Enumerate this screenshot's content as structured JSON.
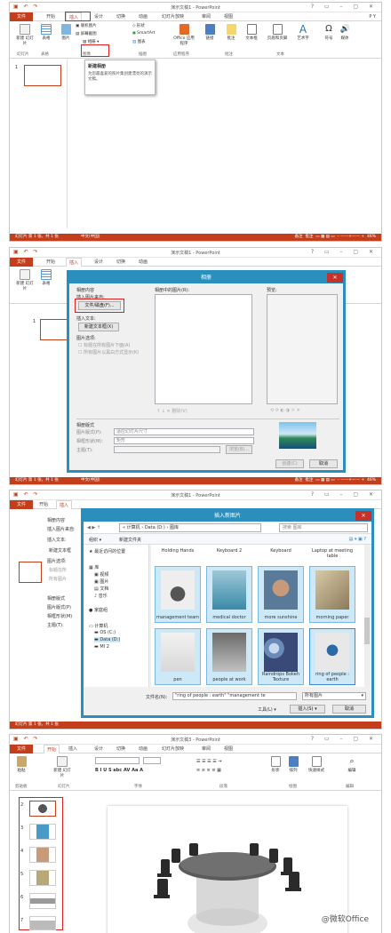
{
  "p1": {
    "title": "演示文稿1 - PowerPoint",
    "tabs": [
      "文件",
      "开始",
      "插入",
      "设计",
      "切换",
      "动画",
      "幻灯片放映",
      "审阅",
      "视图"
    ],
    "user": "P Y",
    "buttons": {
      "new_slide": "新建\n幻灯片",
      "table": "表格",
      "image": "图片",
      "online_image": "联机图片",
      "screenshot": "屏幕截图",
      "album": "相册",
      "shapes": "形状",
      "smartart": "SmartArt",
      "chart": "图表",
      "office_apps": "Office\n应用程序",
      "link": "链接",
      "comment": "批注",
      "textbox": "文本框",
      "header_footer": "页眉和页脚",
      "wordart": "艺术字",
      "symbol": "符号",
      "media": "媒体"
    },
    "groups": {
      "slides": "幻灯片",
      "tables": "表格",
      "images": "图像",
      "illustrations": "插图",
      "apps": "应用程序",
      "comments": "批注",
      "text": "文本"
    },
    "tooltip": {
      "title": "新建相册",
      "body": "为您最喜爱的照片集创建漂亮的演示文稿。"
    },
    "slide_num": "1",
    "status": "幻灯片 第 1 张，共 1 张",
    "lang": "中文(中国)",
    "notes": "备注",
    "comments": "批注",
    "zoom": "46%"
  },
  "p2": {
    "title": "演示文稿1 - PowerPoint",
    "dialog_title": "相册",
    "album_content": "相册内容",
    "insert_from": "插入图片来自:",
    "file_disk": "文件/磁盘(F)...",
    "insert_text": "插入文本:",
    "new_textbox": "新建文本框(X)",
    "pic_options": "图片选项:",
    "captions": "标题在所有图片下面(A)",
    "bw": "所有图片以黑白方式显示(K)",
    "pics_in_album": "相册中的图片(R):",
    "preview": "预览:",
    "remove": "删除(V)",
    "layout": "相册版式",
    "pic_layout_lbl": "图片版式(P):",
    "pic_layout_val": "适应幻灯片尺寸",
    "frame_lbl": "相框形状(M):",
    "frame_val": "矩形",
    "theme_lbl": "主题(T):",
    "browse": "浏览(B)...",
    "create": "创建(C)",
    "cancel": "取消",
    "status": "幻灯片 第 1 张，共 1 张",
    "lang": "中文(中国)",
    "notes": "备注",
    "comments": "批注",
    "zoom": "46%"
  },
  "p3": {
    "title": "演示文稿1 - PowerPoint",
    "dialog_title": "插入新图片",
    "breadcrumb": "« 计算机 › Data (D:) › 图库",
    "search": "搜索 图库",
    "organize": "组织 ▾",
    "new_folder": "新建文件夹",
    "nav": [
      "最近访问的位置",
      "库",
      "视频",
      "图片",
      "文档",
      "音乐",
      "家庭组",
      "计算机",
      "OS (C:)",
      "Data (D:)",
      "MI 2"
    ],
    "col_heads": [
      "Holding Hands",
      "Keyboard 2",
      "Keyboard",
      "Laptop at meeting table"
    ],
    "photos": [
      "management team",
      "medical doctor",
      "more sunshine",
      "morning paper",
      "pen",
      "people at work",
      "Raindrops Bokeh Texture",
      "ring of people : earth"
    ],
    "filename_lbl": "文件名(N):",
    "filename_val": "\"ring of people : earth\" \"management te",
    "filetype": "所有图片",
    "tools": "工具(L)",
    "insert": "插入(S)",
    "cancel": "取消",
    "side_labels": [
      "相册内容",
      "插入图片来自:",
      "插入文本:",
      "新建文本框",
      "图片选项:",
      "标题在所",
      "所有图片",
      "相册版式",
      "图片版式(P)",
      "相框形状(M)",
      "主题(T):"
    ],
    "status": "幻灯片 第 1 张，共 1 张"
  },
  "p4": {
    "title": "演示文稿3 - PowerPoint",
    "tabs": [
      "文件",
      "开始",
      "插入",
      "设计",
      "切换",
      "动画",
      "幻灯片放映",
      "审阅",
      "视图"
    ],
    "groups": {
      "clipboard": "剪贴板",
      "slides": "幻灯片",
      "font": "字体",
      "paragraph": "段落",
      "drawing": "绘图",
      "editing": "编辑"
    },
    "buttons": {
      "paste": "粘贴",
      "new_slide": "新建\n幻灯片",
      "shapes": "形状",
      "arrange": "排列",
      "quick_styles": "快速样式",
      "edit": "编辑"
    },
    "slide_nums": [
      "2",
      "3",
      "4",
      "5",
      "6",
      "7"
    ],
    "watermark": "@微软Office"
  }
}
